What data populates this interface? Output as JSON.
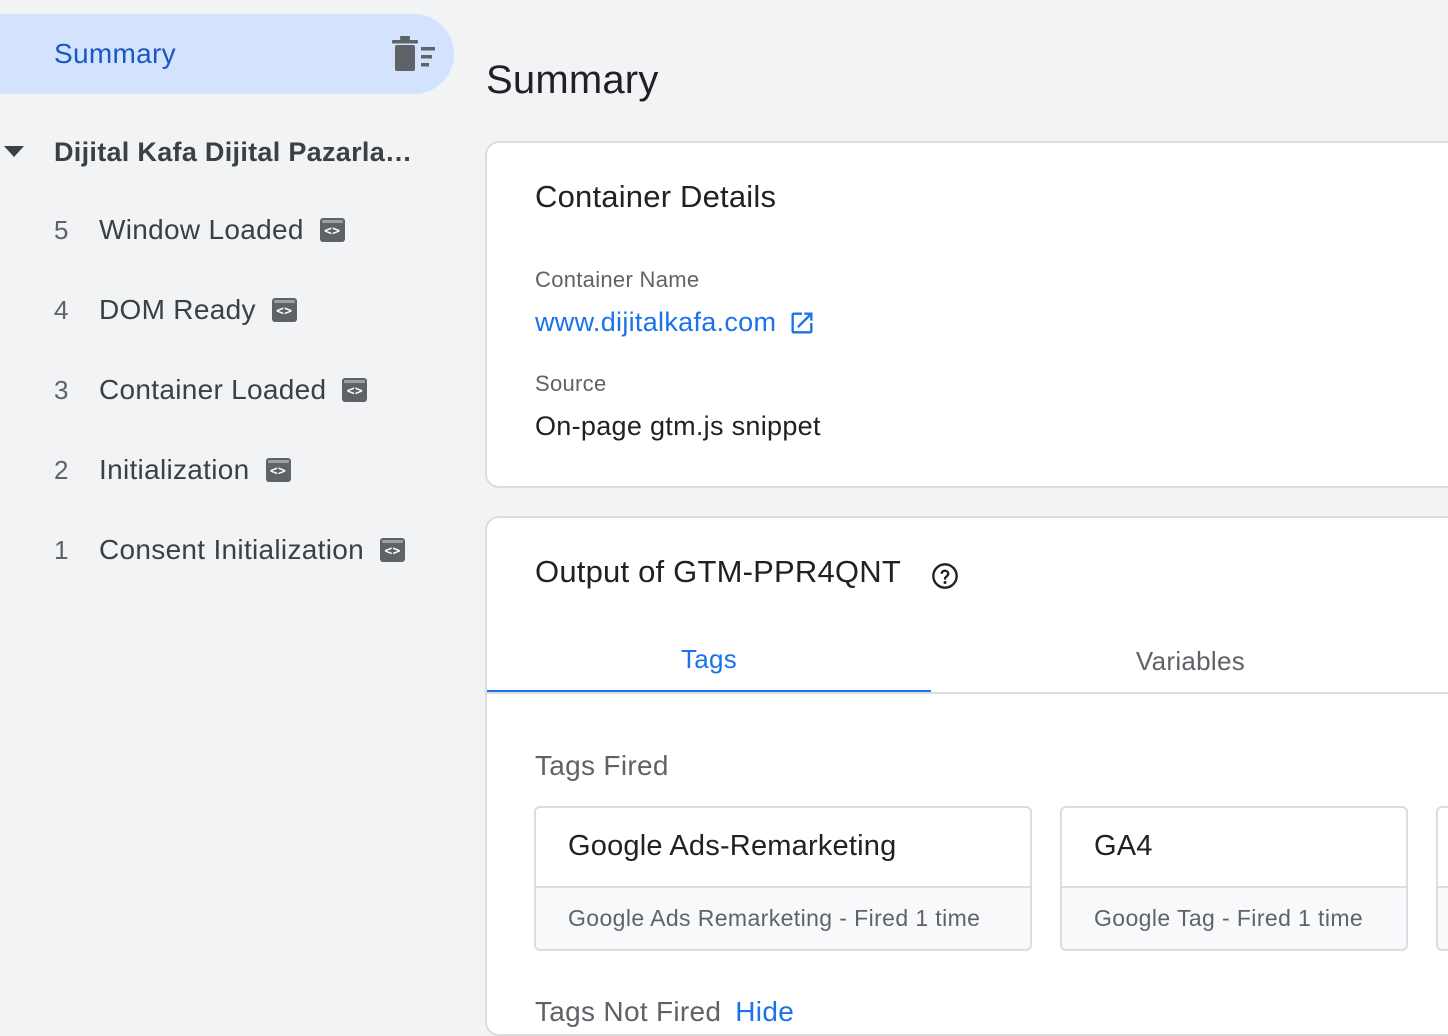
{
  "sidebar": {
    "summary_label": "Summary",
    "page_title": "Dijital Kafa Dijital Pazarlama Ajansı",
    "events": [
      {
        "number": "5",
        "name": "Window Loaded"
      },
      {
        "number": "4",
        "name": "DOM Ready"
      },
      {
        "number": "3",
        "name": "Container Loaded"
      },
      {
        "number": "2",
        "name": "Initialization"
      },
      {
        "number": "1",
        "name": "Consent Initialization"
      }
    ]
  },
  "main": {
    "title": "Summary",
    "container_details": {
      "title": "Container Details",
      "name_label": "Container Name",
      "name_value": "www.dijitalkafa.com",
      "source_label": "Source",
      "source_value": "On-page gtm.js snippet"
    },
    "output": {
      "title": "Output of GTM-PPR4QNT",
      "tabs": [
        {
          "label": "Tags",
          "active": true
        },
        {
          "label": "Variables",
          "active": false
        }
      ],
      "tags_fired_label": "Tags Fired",
      "tags_fired": [
        {
          "name": "Google Ads-Remarketing",
          "detail": "Google Ads Remarketing - Fired 1 time"
        },
        {
          "name": "GA4",
          "detail": "Google Tag - Fired 1 time"
        }
      ],
      "tags_not_fired_label": "Tags Not Fired",
      "hide_link": "Hide"
    }
  },
  "colors": {
    "accent": "#1a73e8",
    "selected_bg": "#d3e3fd",
    "page_bg": "#f1f3f4"
  }
}
